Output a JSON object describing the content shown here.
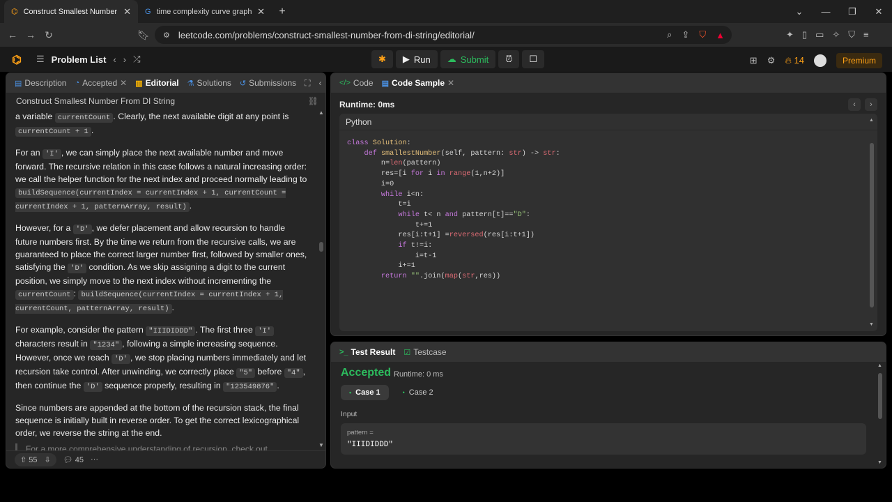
{
  "browser": {
    "tabs": [
      {
        "title": "Construct Smallest Number From DI String"
      },
      {
        "title": "time complexity curve graph - Google Search"
      }
    ],
    "url": "leetcode.com/problems/construct-smallest-number-from-di-string/editorial/",
    "ext_badge": "0"
  },
  "lc": {
    "problem_list": "Problem List",
    "run": "Run",
    "submit": "Submit",
    "streak": "14",
    "premium": "Premium"
  },
  "left_tabs": {
    "description": "Description",
    "accepted": "Accepted",
    "editorial": "Editorial",
    "solutions": "Solutions",
    "submissions": "Submissions"
  },
  "editorial": {
    "title": "Construct Smallest Number From DI String",
    "p1": {
      "a": "a variable ",
      "c1": "currentCount",
      "b": ". Clearly, the next available digit at any point is ",
      "c2": "currentCount + 1",
      "d": "."
    },
    "p2": {
      "a": "For an ",
      "c1": "'I'",
      "b": ", we can simply place the next available number and move forward. The recursive relation in this case follows a natural increasing order: we call the helper function for the next index and proceed normally leading to ",
      "c2": "buildSequence(currentIndex = currentIndex + 1, currentCount = currentIndex + 1, patternArray, result)",
      "d": "."
    },
    "p3": {
      "a": "However, for a ",
      "c1": "'D'",
      "b": ", we defer placement and allow recursion to handle future numbers first. By the time we return from the recursive calls, we are guaranteed to place the correct larger number first, followed by smaller ones, satisfying the ",
      "c2": "'D'",
      "c": " condition. As we skip assigning a digit to the current position, we simply move to the next index without incrementing the ",
      "c3": "currentCount",
      "e": ": ",
      "c4": "buildSequence(currentIndex = currentIndex + 1, currentCount, patternArray, result)",
      "d": "."
    },
    "p4": {
      "a": "For example, consider the pattern ",
      "c1": "\"IIIDIDDD\"",
      "b": ". The first three ",
      "c2": "'I'",
      "c": " characters result in ",
      "c3": "\"1234\"",
      "e": ", following a simple increasing sequence. However, once we reach ",
      "c4": "'D'",
      "f": ", we stop placing numbers immediately and let recursion take control. After unwinding, we correctly place ",
      "c5": "\"5\"",
      "g": " before ",
      "c6": "\"4\"",
      "h": ", then continue the ",
      "c7": "'D'",
      "i": " sequence properly, resulting in ",
      "c8": "\"123549876\"",
      "d": "."
    },
    "p5": "Since numbers are appended at the bottom of the recursion stack, the final sequence is initially built in reverse order. To get the correct lexicographical order, we reverse the string at the end.",
    "p6": "For a more comprehensive understanding of recursion, check out",
    "upvotes": "55",
    "comments": "45"
  },
  "right_tabs": {
    "code": "Code",
    "code_sample": "Code Sample"
  },
  "code_panel": {
    "runtime": "Runtime: 0ms",
    "language": "Python"
  },
  "test": {
    "tab_result": "Test Result",
    "tab_testcase": "Testcase",
    "status": "Accepted",
    "runtime": "Runtime: 0 ms",
    "cases": [
      "Case 1",
      "Case 2"
    ],
    "input_label": "Input",
    "param_name": "pattern =",
    "param_value": "\"IIIDIDDD\""
  },
  "icons": [
    "back-icon",
    "forward-icon",
    "reload-icon",
    "bookmark-icon",
    "site-info-icon",
    "zoom-icon",
    "share-icon",
    "brave-shield-icon",
    "extension-icon",
    "sidebar-icon",
    "wallet-icon",
    "leetcode-logo-icon",
    "list-icon",
    "shuffle-icon",
    "debug-icon",
    "play-icon",
    "upload-icon",
    "timer-icon",
    "note-icon",
    "grid-icon",
    "settings-icon",
    "fire-icon",
    "expand-icon",
    "collapse-icon",
    "link-icon",
    "upvote-icon",
    "downvote-icon",
    "comment-icon",
    "more-icon"
  ]
}
